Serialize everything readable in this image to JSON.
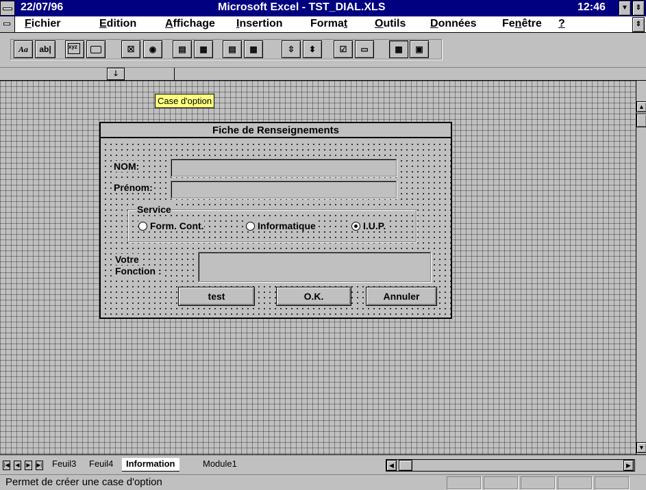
{
  "titlebar": {
    "date": "22/07/96",
    "title": "Microsoft Excel - TST_DIAL.XLS",
    "time": "12:46"
  },
  "menu": {
    "items": [
      {
        "pre": "",
        "hot": "F",
        "post": "ichier"
      },
      {
        "pre": "",
        "hot": "E",
        "post": "dition"
      },
      {
        "pre": "",
        "hot": "A",
        "post": "ffichage"
      },
      {
        "pre": "",
        "hot": "I",
        "post": "nsertion"
      },
      {
        "pre": "Forma",
        "hot": "t",
        "post": ""
      },
      {
        "pre": "",
        "hot": "O",
        "post": "utils"
      },
      {
        "pre": "",
        "hot": "D",
        "post": "onnées"
      },
      {
        "pre": "Fe",
        "hot": "n",
        "post": "être"
      },
      {
        "pre": "",
        "hot": "?",
        "post": ""
      }
    ]
  },
  "toolbar": {
    "label_tool": "Aa",
    "editbox_tool": "ab|",
    "groupbox_tool": "xyz",
    "icons": [
      "label-icon",
      "edit-box-icon",
      "group-box-icon",
      "button-icon",
      "checkbox-icon",
      "option-button-icon",
      "list-box-icon",
      "drop-down-icon",
      "combo-list-edit-icon",
      "combo-drop-down-edit-icon",
      "scroll-bar-icon",
      "spinner-icon",
      "control-properties-icon",
      "edit-code-icon",
      "toggle-grid-icon",
      "run-dialog-icon"
    ]
  },
  "tooltip": "Case d'option",
  "dialog": {
    "title": "Fiche de Renseignements",
    "nom_label": "NOM:",
    "prenom_label": "Prénom:",
    "service_label": "Service",
    "options": [
      {
        "label": "Form. Cont.",
        "selected": false
      },
      {
        "label": "Informatique",
        "selected": false
      },
      {
        "label": "I.U.P.",
        "selected": true
      }
    ],
    "fonction_label_1": "Votre",
    "fonction_label_2": "Fonction :",
    "buttons": {
      "test": "test",
      "ok": "O.K.",
      "cancel": "Annuler"
    }
  },
  "sheet_tabs": {
    "tabs": [
      "Feuil3",
      "Feuil4",
      "Information",
      "Module1"
    ],
    "active": "Information"
  },
  "statusbar": {
    "text": "Permet de créer une case d'option"
  }
}
